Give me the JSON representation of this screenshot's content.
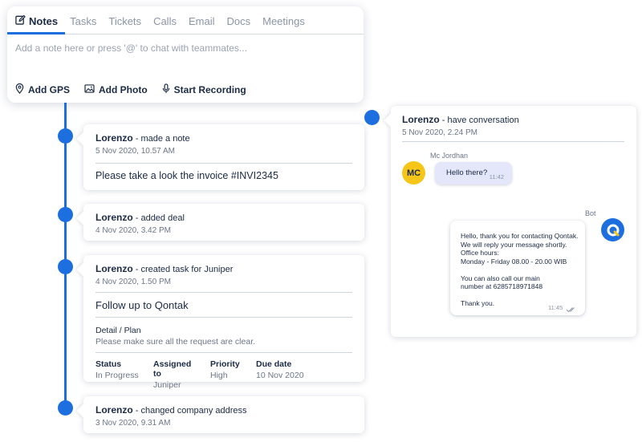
{
  "composer": {
    "tabs": [
      {
        "label": "Notes",
        "icon": "edit-icon"
      },
      {
        "label": "Tasks"
      },
      {
        "label": "Tickets"
      },
      {
        "label": "Calls"
      },
      {
        "label": "Email"
      },
      {
        "label": "Docs"
      },
      {
        "label": "Meetings"
      }
    ],
    "placeholder": "Add a note here or press '@' to chat with teammates...",
    "actions": [
      {
        "label": "Add GPS",
        "icon": "map-pin-icon"
      },
      {
        "label": "Add Photo",
        "icon": "image-icon"
      },
      {
        "label": "Start Recording",
        "icon": "microphone-icon"
      }
    ]
  },
  "timeline": [
    {
      "author": "Lorenzo",
      "action": "- made a note",
      "date": "5 Nov 2020, 10.57 AM",
      "body": "Please take a look the invoice #INVI2345"
    },
    {
      "author": "Lorenzo",
      "action": "- added deal",
      "date": "4 Nov 2020, 3.42 PM"
    },
    {
      "author": "Lorenzo",
      "action": "- created task for Juniper",
      "date": "4 Nov 2020, 1.50 PM",
      "task_title": "Follow up to Qontak",
      "detail_label": "Detail / Plan",
      "detail_value": "Please make sure all the request are clear.",
      "meta": [
        {
          "key": "Status",
          "value": "In Progress"
        },
        {
          "key": "Assigned to",
          "value": "Juniper"
        },
        {
          "key": "Priority",
          "value": "High"
        },
        {
          "key": "Due date",
          "value": "10 Nov 2020"
        }
      ]
    },
    {
      "author": "Lorenzo",
      "action": "- changed company address",
      "date": "3 Nov 2020, 9.31 AM"
    }
  ],
  "conversation": {
    "author": "Lorenzo",
    "action": "- have conversation",
    "date": "5 Nov 2020, 2.24 PM",
    "agent_name": "Mc Jordhan",
    "agent_initials": "MC",
    "incoming_message": "Hello there?",
    "incoming_time": "11:42",
    "bot_name": "Bot",
    "bot_message": "Hello, thank you for contacting Qontak.\nWe will reply your message shortly.\nOffice hours:\nMonday - Friday 08.00 - 20.00 WIB\n\nYou can also call our main\nnumber at 6285718971848\n\nThank you.",
    "bot_time": "11:45"
  },
  "colors": {
    "accent": "#1d6fe0",
    "avatar": "#f5c518",
    "incoming_bubble": "#e4e7fa"
  }
}
